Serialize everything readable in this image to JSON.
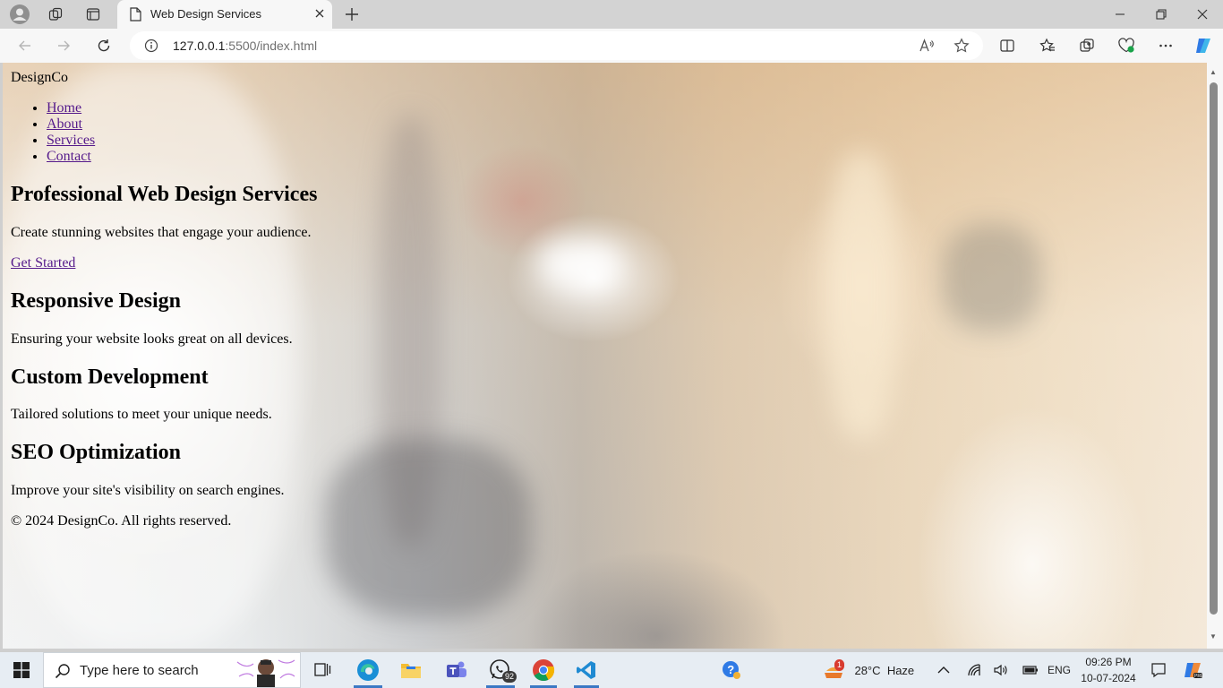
{
  "browser": {
    "tab_title": "Web Design Services",
    "url_host": "127.0.0.1",
    "url_rest": ":5500/index.html"
  },
  "site": {
    "logo": "DesignCo",
    "nav": [
      "Home",
      "About",
      "Services",
      "Contact"
    ],
    "hero_title": "Professional Web Design Services",
    "hero_text": "Create stunning websites that engage your audience.",
    "cta": "Get Started",
    "features": [
      {
        "title": "Responsive Design",
        "text": "Ensuring your website looks great on all devices."
      },
      {
        "title": "Custom Development",
        "text": "Tailored solutions to meet your unique needs."
      },
      {
        "title": "SEO Optimization",
        "text": "Improve your site's visibility on search engines."
      }
    ],
    "footer": "© 2024 DesignCo. All rights reserved."
  },
  "taskbar": {
    "search_placeholder": "Type here to search",
    "whatsapp_badge": "92",
    "weather_badge": "1",
    "temperature": "28°C",
    "weather": "Haze",
    "language": "ENG",
    "time": "09:26 PM",
    "date": "10-07-2024"
  },
  "colors": {
    "link_visited": "#551a8b",
    "taskbar_bg": "#e7edf3",
    "accent": "#3b78c4"
  }
}
